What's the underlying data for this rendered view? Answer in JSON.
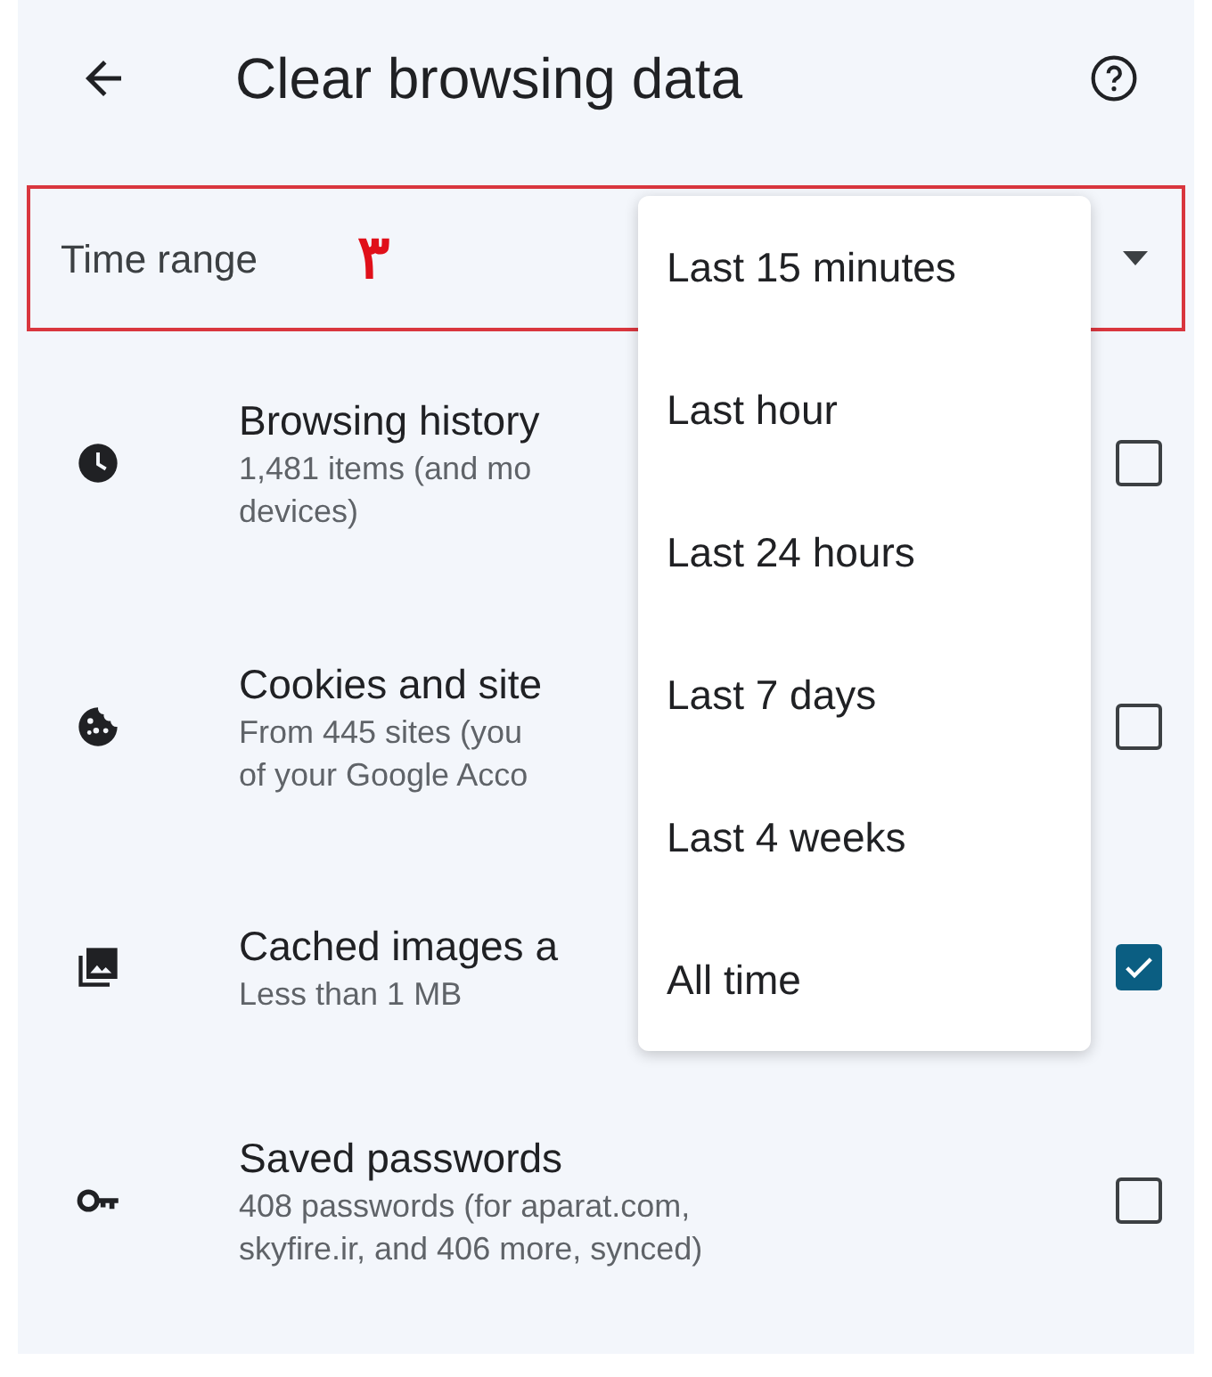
{
  "header": {
    "title": "Clear browsing data"
  },
  "time_range": {
    "label": "Time range",
    "annotation": "۳",
    "menu": [
      {
        "label": "Last 15 minutes"
      },
      {
        "label": "Last hour"
      },
      {
        "label": "Last 24 hours"
      },
      {
        "label": "Last 7 days"
      },
      {
        "label": "Last 4 weeks"
      },
      {
        "label": "All time"
      }
    ]
  },
  "items": [
    {
      "kind": "history",
      "title": "Browsing history",
      "details": [
        "1,481 items (and mo",
        "devices)"
      ],
      "checked": false
    },
    {
      "kind": "cookies",
      "title": "Cookies and site",
      "details": [
        "From 445 sites (you",
        "of your Google Acco"
      ],
      "checked": false
    },
    {
      "kind": "images",
      "title": "Cached images a",
      "details": [
        "Less than 1 MB"
      ],
      "checked": true
    },
    {
      "kind": "passwords",
      "title": "Saved passwords",
      "details": [
        "408 passwords (for aparat.com,",
        "skyfire.ir, and 406 more, synced)"
      ],
      "checked": false
    }
  ]
}
